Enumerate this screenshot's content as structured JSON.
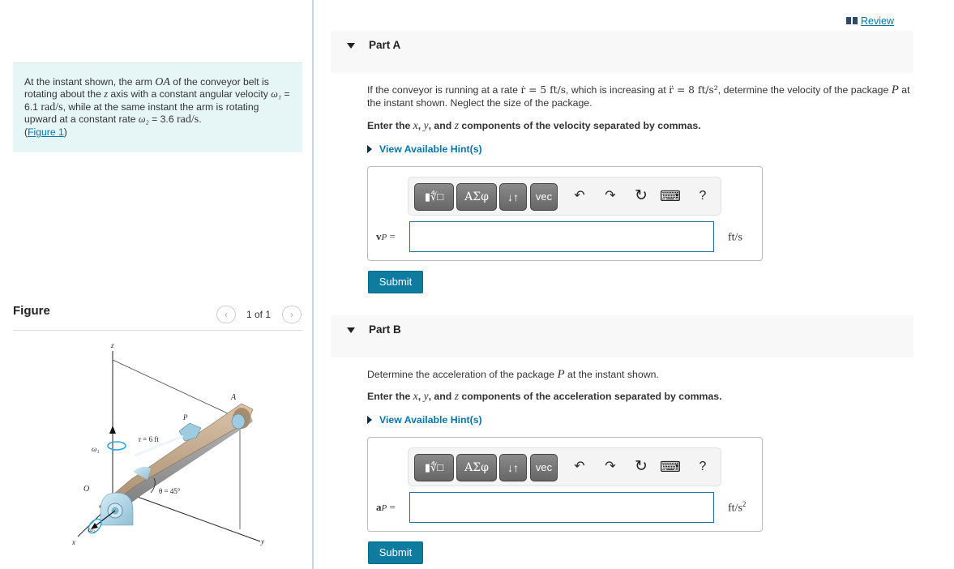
{
  "problem": {
    "text_1": "At the instant shown, the arm ",
    "arm_label": "OA",
    "text_2": " of the conveyor belt is rotating about the ",
    "axis": "z",
    "text_3": " axis with a constant angular velocity ",
    "omega1_symbol": "ω₁",
    "omega1_value": " = 6.1 ",
    "omega1_unit": "rad/s",
    "text_4": ", while at the same instant the arm is rotating upward at a constant rate ",
    "omega2_symbol": "ω₂",
    "omega2_value": " = 3.6 ",
    "omega2_unit": "rad/s",
    "text_5": ".",
    "figure_link_open": "(",
    "figure_link": "Figure 1",
    "figure_link_close": ")"
  },
  "figure": {
    "title": "Figure",
    "pager": "1 of 1",
    "prev_icon": "‹",
    "next_icon": "›",
    "labels": {
      "z": "z",
      "x": "x",
      "y": "y",
      "O": "O",
      "A": "A",
      "P": "P",
      "r": "r = 6 ft",
      "theta": "θ = 45°",
      "omega1": "ω₁",
      "omega2": "ω₂"
    }
  },
  "review": {
    "label": "Review",
    "icon": "book-icon"
  },
  "parts": [
    {
      "label": "Part A",
      "question_1": "If the conveyor is running at a rate ",
      "rdot": "ṙ = 5 ft/s",
      "question_2": ", which is increasing at ",
      "rddot": "r̈ = 8 ft/s²",
      "question_3": ", determine the velocity of the package ",
      "package": "P",
      "question_4": " at the instant shown. Neglect the size of the package.",
      "instruction_1": "Enter the ",
      "instruction_x": "x",
      "instruction_sep1": ", ",
      "instruction_y": "y",
      "instruction_sep2": ", and ",
      "instruction_z": "z",
      "instruction_2": " components of the velocity separated by commas.",
      "hint": "View Available Hint(s)",
      "var_bold": "v",
      "var_sub": "P",
      "var_eq": " =",
      "input_value": "",
      "unit": "ft/s",
      "unit_sup": "",
      "submit": "Submit"
    },
    {
      "label": "Part B",
      "question_1": "Determine the acceleration of the package ",
      "package": "P",
      "question_2": " at the instant shown.",
      "instruction_1": "Enter the ",
      "instruction_x": "x",
      "instruction_sep1": ", ",
      "instruction_y": "y",
      "instruction_sep2": ", and ",
      "instruction_z": "z",
      "instruction_2": " components of the acceleration separated by commas.",
      "hint": "View Available Hint(s)",
      "var_bold": "a",
      "var_sub": "P",
      "var_eq": " =",
      "input_value": "",
      "unit": "ft/s",
      "unit_sup": "2",
      "submit": "Submit"
    }
  ],
  "toolbar": {
    "templates": "▮∜□",
    "greek": "ΑΣφ",
    "arrows": "↓↑",
    "vec": "vec",
    "undo": "↶",
    "redo": "↷",
    "reset": "↻",
    "keyboard": "⌨",
    "help": "?"
  },
  "colors": {
    "accent": "#0076a8",
    "submit": "#0e7c9f",
    "problem_bg": "#e6f6f7",
    "part_header_bg": "#f8f8f8"
  }
}
